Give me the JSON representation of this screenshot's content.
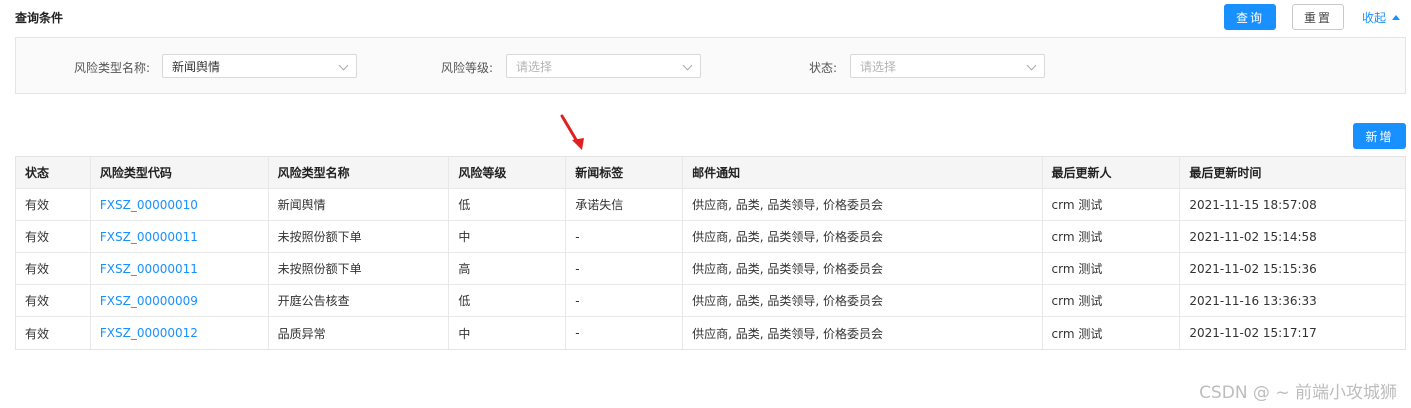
{
  "header": {
    "title": "查询条件",
    "query_label": "查询",
    "reset_label": "重置",
    "collapse_label": "收起"
  },
  "filters": [
    {
      "label": "风险类型名称:",
      "value": "新闻舆情",
      "placeholder": ""
    },
    {
      "label": "风险等级:",
      "value": "",
      "placeholder": "请选择"
    },
    {
      "label": "状态:",
      "value": "",
      "placeholder": "请选择"
    }
  ],
  "add_label": "新增",
  "table": {
    "columns": [
      "状态",
      "风险类型代码",
      "风险类型名称",
      "风险等级",
      "新闻标签",
      "邮件通知",
      "最后更新人",
      "最后更新时间"
    ],
    "rows": [
      [
        "有效",
        "FXSZ_00000010",
        "新闻舆情",
        "低",
        "承诺失信",
        "供应商, 品类, 品类领导, 价格委员会",
        "crm 测试",
        "2021-11-15 18:57:08"
      ],
      [
        "有效",
        "FXSZ_00000011",
        "未按照份额下单",
        "中",
        "-",
        "供应商, 品类, 品类领导, 价格委员会",
        "crm 测试",
        "2021-11-02 15:14:58"
      ],
      [
        "有效",
        "FXSZ_00000011",
        "未按照份额下单",
        "高",
        "-",
        "供应商, 品类, 品类领导, 价格委员会",
        "crm 测试",
        "2021-11-02 15:15:36"
      ],
      [
        "有效",
        "FXSZ_00000009",
        "开庭公告核查",
        "低",
        "-",
        "供应商, 品类, 品类领导, 价格委员会",
        "crm 测试",
        "2021-11-16 13:36:33"
      ],
      [
        "有效",
        "FXSZ_00000012",
        "品质异常",
        "中",
        "-",
        "供应商, 品类, 品类领导, 价格委员会",
        "crm 测试",
        "2021-11-02 15:17:17"
      ]
    ]
  },
  "watermark": "CSDN @ ~ 前端小攻城狮",
  "colors": {
    "primary": "#1890ff",
    "arrow": "#e02020"
  }
}
